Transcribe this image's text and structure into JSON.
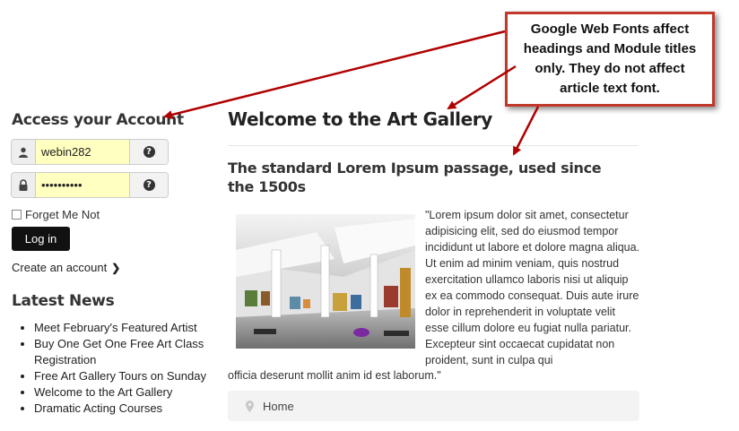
{
  "login": {
    "title": "Access your Account",
    "username_value": "webin282",
    "password_value": "••••••••••",
    "remember_label": "Forget Me Not",
    "login_button": "Log in",
    "create_account": "Create an account"
  },
  "news": {
    "title": "Latest News",
    "items": [
      "Meet February's Featured Artist",
      "Buy One Get One Free Art Class Registration",
      "Free Art Gallery Tours on Sunday",
      "Welcome to the Art Gallery",
      "Dramatic Acting Courses"
    ]
  },
  "article": {
    "page_title": "Welcome to the Art Gallery",
    "heading": "The standard Lorem Ipsum passage, used since the 1500s",
    "body_wrap": "\"Lorem ipsum dolor sit amet, consectetur adipisicing elit, sed do eiusmod tempor incididunt ut labore et dolore magna aliqua. Ut enim ad minim veniam, quis nostrud exercitation ullamco laboris nisi ut aliquip ex ea commodo consequat. Duis aute irure dolor in reprehenderit in voluptate velit esse cillum dolore eu fugiat nulla pariatur. Excepteur sint occaecat cupidatat non proident, sunt in culpa qui",
    "body_tail": "officia deserunt mollit anim id est laborum.\""
  },
  "breadcrumb": {
    "home": "Home"
  },
  "callout": {
    "text": "Google Web Fonts affect headings and Module titles only. They do not affect article text font."
  },
  "colors": {
    "callout_border": "#c0392b",
    "arrow": "#b00000",
    "input_highlight": "#ffffc0"
  },
  "icons": [
    "user-icon",
    "lock-icon",
    "question-icon",
    "chevron-right-icon",
    "map-pin-icon"
  ]
}
